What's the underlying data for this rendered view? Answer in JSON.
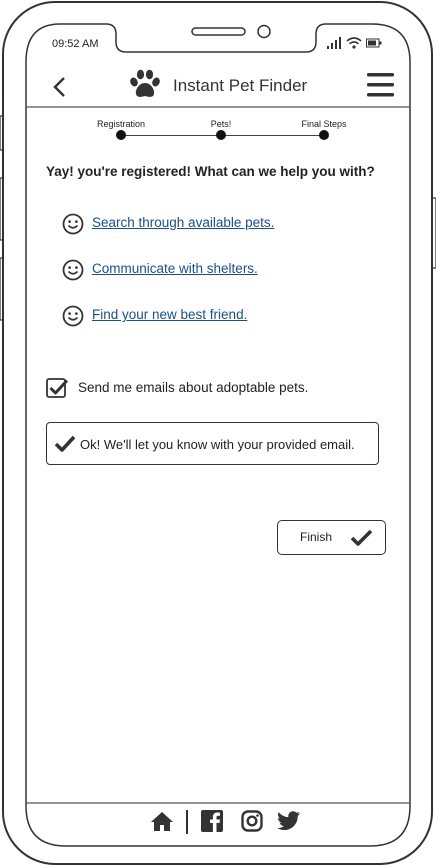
{
  "status_bar": {
    "time": "09:52 AM"
  },
  "header": {
    "title": "Instant Pet Finder"
  },
  "progress": {
    "steps": [
      "Registration",
      "Pets!",
      "Final Steps"
    ]
  },
  "main": {
    "heading": "Yay! you're registered! What can we help you with?",
    "links": [
      "Search through available pets.",
      "Communicate with shelters.",
      "Find your new best friend."
    ],
    "email_checkbox": {
      "label": "Send me emails about adoptable pets.",
      "checked": true
    },
    "confirmation": "Ok! We'll let you know with your provided email.",
    "finish_button": "Finish"
  },
  "icons": {
    "back": "chevron-left-icon",
    "logo": "paw-icon",
    "menu": "hamburger-menu-icon",
    "link_bullet": "smiley-icon",
    "check": "checkmark-icon",
    "footer": [
      "home-icon",
      "facebook-icon",
      "instagram-icon",
      "twitter-icon"
    ]
  }
}
